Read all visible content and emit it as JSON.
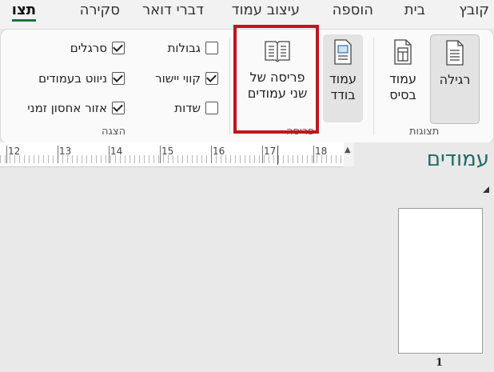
{
  "tabs": [
    "קובץ",
    "בית",
    "הוספה",
    "עיצוב עמוד",
    "דברי דואר",
    "סקירה",
    "תצו"
  ],
  "views_group": {
    "label": "תצוגות",
    "normal": "רגילה",
    "draft_line1": "עמוד",
    "draft_line2": "בסיס",
    "single_line1": "עמוד",
    "single_line2": "בודד"
  },
  "layout_group": {
    "label": "פריסה",
    "two_page_line1": "פריסה של",
    "two_page_line2": "שני עמודים"
  },
  "show_group": {
    "label": "הצגה",
    "rulers": {
      "label": "סרגלים",
      "checked": true
    },
    "navigation": {
      "label": "ניווט בעמודים",
      "checked": true
    },
    "temp_storage": {
      "label": "אזור אחסון זמני",
      "checked": true
    },
    "borders": {
      "label": "גבולות",
      "checked": false
    },
    "alignment": {
      "label": "קווי יישור",
      "checked": true
    },
    "fields": {
      "label": "שדות",
      "checked": false
    }
  },
  "ruler_numbers": [
    "12",
    "13",
    "14",
    "15",
    "16",
    "17",
    "18"
  ],
  "pages_panel": {
    "title": "עמודים",
    "page_number": "1"
  }
}
